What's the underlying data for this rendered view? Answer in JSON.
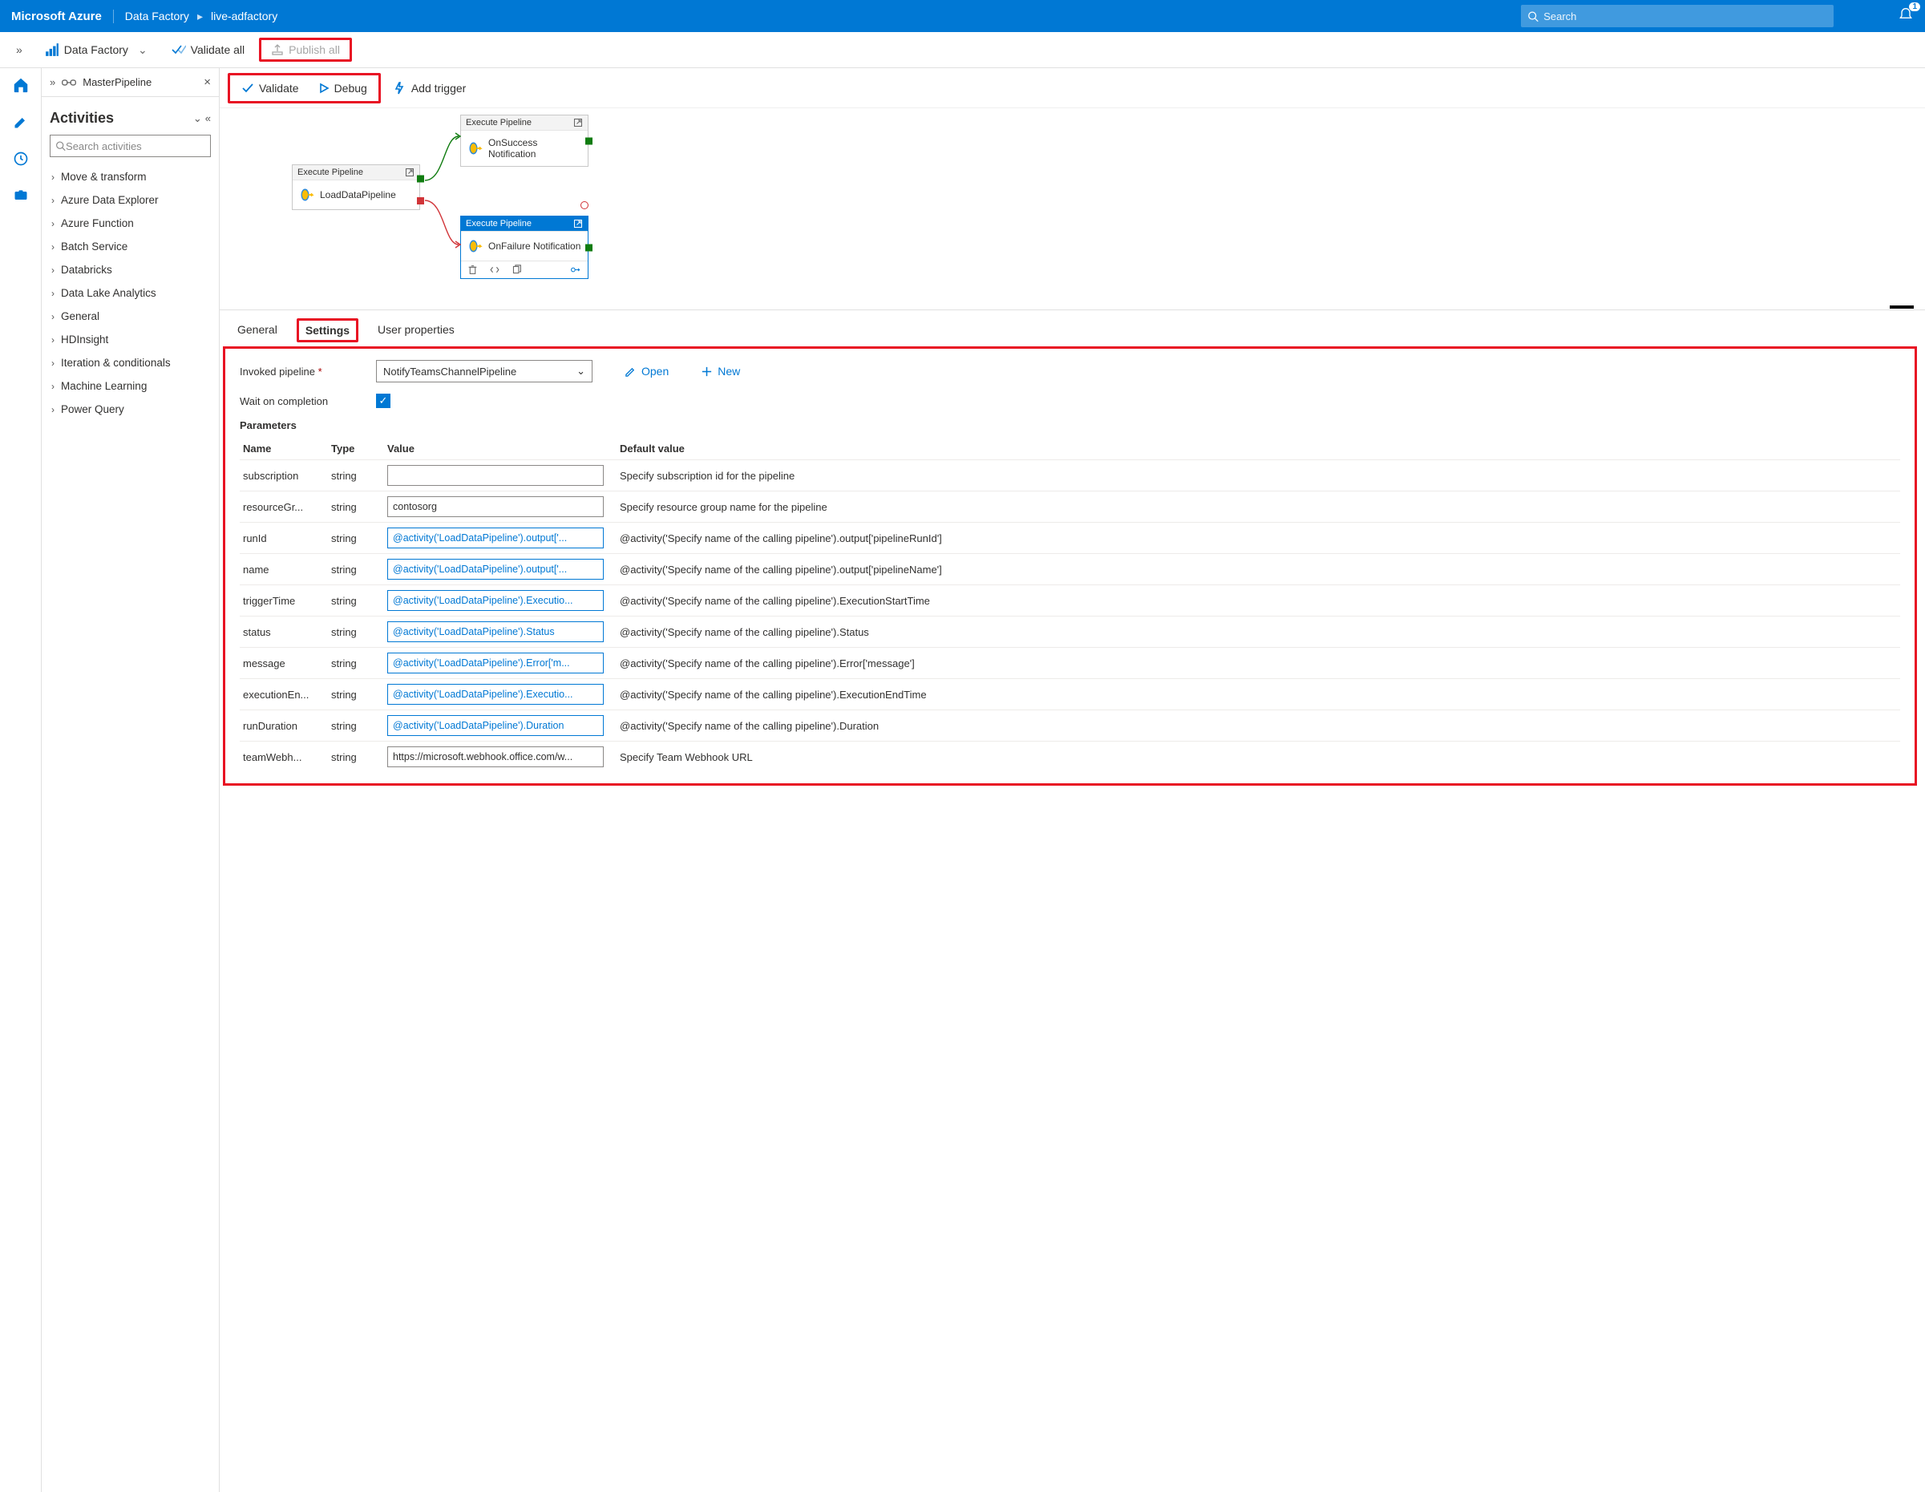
{
  "topbar": {
    "brand": "Microsoft Azure",
    "crumb1": "Data Factory",
    "crumb2": "live-adfactory",
    "search_placeholder": "Search",
    "notif_count": "1"
  },
  "ribbon": {
    "data_factory": "Data Factory",
    "validate_all": "Validate all",
    "publish_all": "Publish all"
  },
  "tab": {
    "name": "MasterPipeline"
  },
  "activities": {
    "title": "Activities",
    "search_placeholder": "Search activities",
    "cats": [
      "Move & transform",
      "Azure Data Explorer",
      "Azure Function",
      "Batch Service",
      "Databricks",
      "Data Lake Analytics",
      "General",
      "HDInsight",
      "Iteration & conditionals",
      "Machine Learning",
      "Power Query"
    ]
  },
  "canvas_toolbar": {
    "validate": "Validate",
    "debug": "Debug",
    "add_trigger": "Add trigger"
  },
  "nodes": {
    "exec_label": "Execute Pipeline",
    "load": "LoadDataPipeline",
    "success": "OnSuccess Notification",
    "failure": "OnFailure Notification"
  },
  "ptabs": {
    "general": "General",
    "settings": "Settings",
    "user_props": "User properties"
  },
  "settings": {
    "invoked_pipeline_lbl": "Invoked pipeline",
    "invoked_pipeline_val": "NotifyTeamsChannelPipeline",
    "open": "Open",
    "new": "New",
    "wait_lbl": "Wait on completion",
    "params_lbl": "Parameters",
    "headers": {
      "name": "Name",
      "type": "Type",
      "value": "Value",
      "default": "Default value"
    },
    "rows": [
      {
        "name": "subscription",
        "type": "string",
        "value": "",
        "style": "plain",
        "default": "Specify subscription id for the pipeline"
      },
      {
        "name": "resourceGr...",
        "type": "string",
        "value": "contosorg",
        "style": "plain",
        "default": "Specify resource group name for the pipeline"
      },
      {
        "name": "runId",
        "type": "string",
        "value": "@activity('LoadDataPipeline').output['...",
        "style": "blue",
        "default": "@activity('Specify name of the calling pipeline').output['pipelineRunId']"
      },
      {
        "name": "name",
        "type": "string",
        "value": "@activity('LoadDataPipeline').output['...",
        "style": "blue",
        "default": "@activity('Specify name of the calling pipeline').output['pipelineName']"
      },
      {
        "name": "triggerTime",
        "type": "string",
        "value": "@activity('LoadDataPipeline').Executio...",
        "style": "blue",
        "default": "@activity('Specify name of the calling pipeline').ExecutionStartTime"
      },
      {
        "name": "status",
        "type": "string",
        "value": "@activity('LoadDataPipeline').Status",
        "style": "blue",
        "default": "@activity('Specify name of the calling pipeline').Status"
      },
      {
        "name": "message",
        "type": "string",
        "value": "@activity('LoadDataPipeline').Error['m...",
        "style": "blue",
        "default": "@activity('Specify name of the calling pipeline').Error['message']"
      },
      {
        "name": "executionEn...",
        "type": "string",
        "value": "@activity('LoadDataPipeline').Executio...",
        "style": "blue",
        "default": "@activity('Specify name of the calling pipeline').ExecutionEndTime"
      },
      {
        "name": "runDuration",
        "type": "string",
        "value": "@activity('LoadDataPipeline').Duration",
        "style": "blue",
        "default": "@activity('Specify name of the calling pipeline').Duration"
      },
      {
        "name": "teamWebh...",
        "type": "string",
        "value": "https://microsoft.webhook.office.com/w...",
        "style": "plain",
        "default": "Specify Team Webhook URL"
      }
    ]
  }
}
